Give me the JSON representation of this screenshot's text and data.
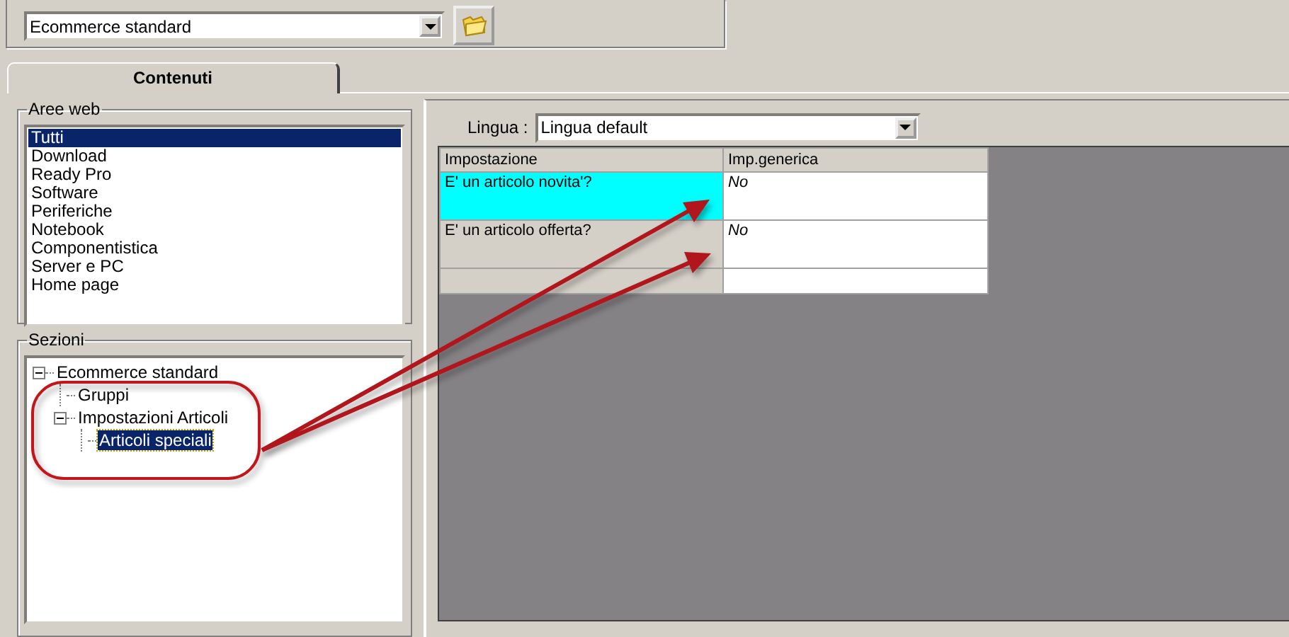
{
  "template": {
    "value": "Ecommerce standard"
  },
  "tabs": [
    {
      "label": "Contenuti",
      "selected": true
    }
  ],
  "aree_web": {
    "title": "Aree web",
    "items": [
      {
        "label": "Tutti",
        "selected": true
      },
      {
        "label": "Download",
        "selected": false
      },
      {
        "label": "Ready Pro",
        "selected": false
      },
      {
        "label": "Software",
        "selected": false
      },
      {
        "label": "Periferiche",
        "selected": false
      },
      {
        "label": "Notebook",
        "selected": false
      },
      {
        "label": "Componentistica",
        "selected": false
      },
      {
        "label": "Server e PC",
        "selected": false
      },
      {
        "label": "Home page",
        "selected": false
      }
    ]
  },
  "sezioni": {
    "title": "Sezioni",
    "tree": [
      {
        "label": "Ecommerce standard",
        "expanded": true,
        "selected": false,
        "children": [
          {
            "label": "Gruppi",
            "selected": false
          },
          {
            "label": "Impostazioni Articoli",
            "expanded": true,
            "selected": false,
            "children": [
              {
                "label": "Articoli speciali",
                "selected": true
              }
            ]
          }
        ]
      }
    ]
  },
  "lingua": {
    "label": "Lingua :",
    "value": "Lingua default"
  },
  "table": {
    "columns": [
      "Impostazione",
      "Imp.generica"
    ],
    "rows": [
      {
        "cells": [
          "E' un articolo novita'?",
          "No"
        ],
        "selected": true
      },
      {
        "cells": [
          "E' un articolo offerta?",
          "No"
        ],
        "selected": false
      },
      {
        "cells": [],
        "selected": false
      }
    ]
  }
}
